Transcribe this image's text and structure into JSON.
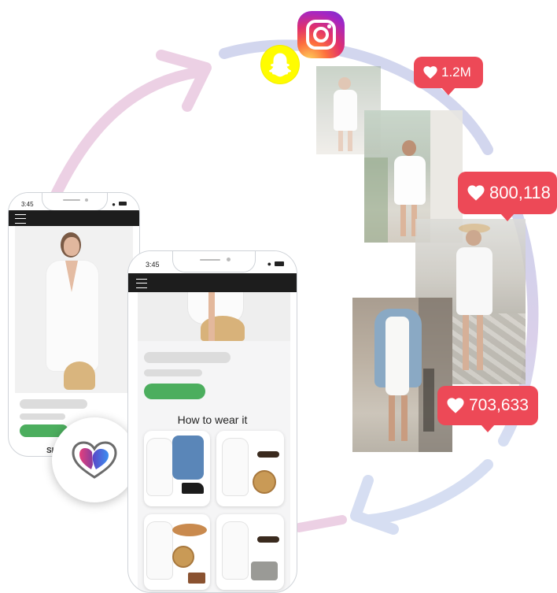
{
  "colors": {
    "arc_pink": "#e9c6de",
    "arc_blue": "#cfd7ec",
    "like_red": "#ed4957",
    "green": "#4cae5e",
    "nav_dark": "#1d1d1d",
    "skeleton": "#dcdcdc"
  },
  "icons": [
    "instagram-icon",
    "snapchat-icon",
    "heart-icon",
    "menu-icon",
    "wifi-icon",
    "battery-icon",
    "signal-icon",
    "dual-heart-logo-icon",
    "cycle-arrow-icon"
  ],
  "likes": [
    {
      "count": "1.2M"
    },
    {
      "count": "800,118"
    },
    {
      "count": "703,633"
    }
  ],
  "phone_back": {
    "time": "3:45",
    "cta_partial": "SH"
  },
  "phone_front": {
    "time": "3:45",
    "section_title": "How to wear it"
  }
}
